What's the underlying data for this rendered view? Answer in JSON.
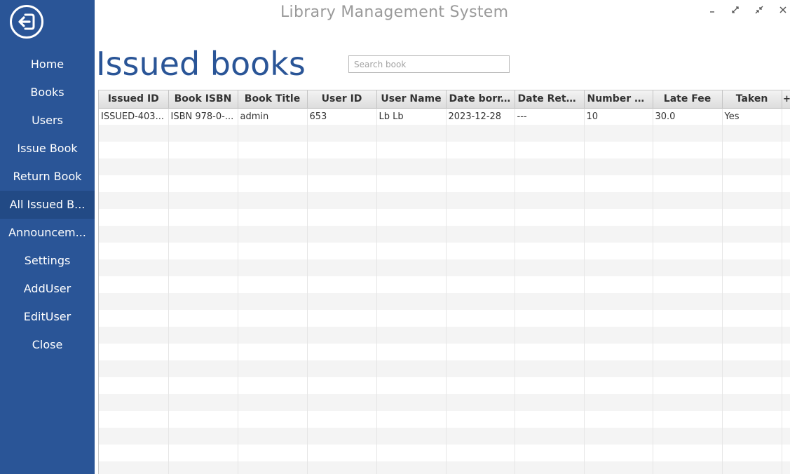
{
  "window": {
    "title": "Library Management System",
    "controls": [
      "minimize-icon",
      "maximize-icon",
      "restore-icon",
      "close-icon"
    ]
  },
  "sidebar": {
    "logout_icon": "logout-icon",
    "active_index": 5,
    "items": [
      {
        "label": "Home"
      },
      {
        "label": "Books"
      },
      {
        "label": "Users"
      },
      {
        "label": "Issue Book"
      },
      {
        "label": "Return Book"
      },
      {
        "label": "All Issued B..."
      },
      {
        "label": "Announcem..."
      },
      {
        "label": "Settings"
      },
      {
        "label": "AddUser"
      },
      {
        "label": "EditUser"
      },
      {
        "label": "Close"
      }
    ]
  },
  "main": {
    "title": "Issued books",
    "search": {
      "placeholder": "Search book",
      "value": ""
    }
  },
  "table": {
    "columns": [
      "Issued ID",
      "Book ISBN",
      "Book Title",
      "User ID",
      "User Name",
      "Date borr...",
      "Date Retu...",
      "Number o...",
      "Late Fee",
      "Taken"
    ],
    "column_menu_icon": "+",
    "rows": [
      [
        "ISSUED-403...",
        "ISBN 978-0-...",
        "admin",
        "653",
        "Lb Lb",
        "2023-12-28",
        "---",
        "10",
        "30.0",
        "Yes"
      ]
    ]
  },
  "colors": {
    "sidebar": "#2a5597",
    "sidebar_active": "#224a85",
    "title": "#2a5597",
    "app_title": "#9a9a9a"
  }
}
